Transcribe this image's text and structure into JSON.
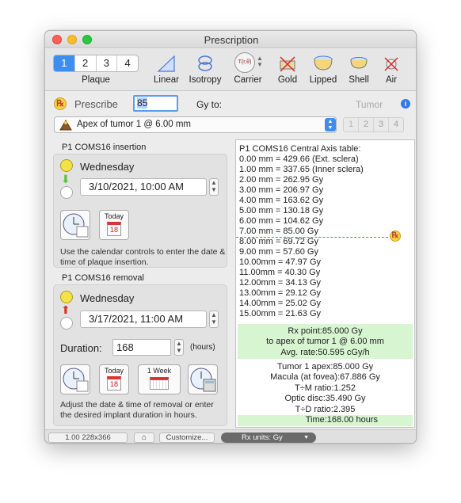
{
  "window": {
    "title": "Prescription"
  },
  "toolbar": {
    "plaque_tabs": [
      "1",
      "2",
      "3",
      "4"
    ],
    "plaque_label": "Plaque",
    "tools": [
      {
        "label": "Linear",
        "icon": "linear-ramp-icon"
      },
      {
        "label": "Isotropy",
        "icon": "isotropy-icon"
      },
      {
        "label": "Carrier",
        "icon": "carrier-icon",
        "glyph": "T(r,θ)"
      },
      {
        "label": "Gold",
        "icon": "gold-crossed-icon"
      },
      {
        "label": "Lipped",
        "icon": "lipped-icon"
      },
      {
        "label": "Shell",
        "icon": "shell-icon"
      },
      {
        "label": "Air",
        "icon": "air-crossed-icon"
      }
    ]
  },
  "prescribe": {
    "label": "Prescribe",
    "rx_symbol": "℞",
    "value": "85",
    "gy_to": "Gy to:",
    "tumor_label": "Tumor",
    "info": "i"
  },
  "point_select": {
    "value": "Apex of tumor 1 @ 6.00 mm"
  },
  "tumor_tabs": [
    "1",
    "2",
    "3",
    "4"
  ],
  "insertion": {
    "title": "P1 COMS16 insertion",
    "day": "Wednesday",
    "datetime": "3/10/2021, 10:00 AM",
    "today_label": "Today",
    "cal_day": "18",
    "help": "Use the calendar controls to enter the date & time of plaque insertion."
  },
  "removal": {
    "title": "P1 COMS16 removal",
    "day": "Wednesday",
    "datetime": "3/17/2021, 11:00 AM",
    "duration_label": "Duration:",
    "duration_value": "168",
    "duration_unit": "(hours)",
    "today_label": "Today",
    "week_label": "1 Week",
    "cal_day": "18",
    "help": "Adjust the date & time of removal or enter the desired implant duration in hours."
  },
  "central_axis": {
    "title": "P1 COMS16 Central Axis table:",
    "rows": [
      "0.00 mm = 429.66 (Ext. sclera)",
      "1.00 mm = 337.65 (Inner sclera)",
      "2.00 mm = 262.95 Gy",
      "3.00 mm = 206.97 Gy",
      "4.00 mm = 163.62 Gy",
      "5.00 mm = 130.18 Gy",
      "6.00 mm = 104.62 Gy",
      "7.00 mm = 85.00 Gy",
      "8.00 mm = 69.72 Gy",
      "9.00 mm = 57.60 Gy",
      "10.00mm = 47.97 Gy",
      "11.00mm = 40.30 Gy",
      "12.00mm = 34.13 Gy",
      "13.00mm = 29.12 Gy",
      "14.00mm = 25.02 Gy",
      "15.00mm = 21.63 Gy"
    ],
    "rx_point": "Rx point:85.000 Gy",
    "rx_to": "to apex of tumor 1 @ 6.00 mm",
    "avg_rate": "Avg. rate:50.595 cGy/h",
    "summary": [
      "Tumor 1 apex:85.000 Gy",
      "Macula (at fovea):67.886 Gy",
      "T÷M ratio:1.252",
      "Optic disc:35.490 Gy",
      "T÷D ratio:2.395"
    ],
    "time": "Time:168.00 hours"
  },
  "statusbar": {
    "size": "1.00 228x366",
    "home": "⌂",
    "customize": "Customize...",
    "rx_units": "Rx units: Gy"
  },
  "colors": {
    "accent": "#3d8ef0",
    "green": "#d6f5d0",
    "highlight_line": "#6a6ad8"
  }
}
